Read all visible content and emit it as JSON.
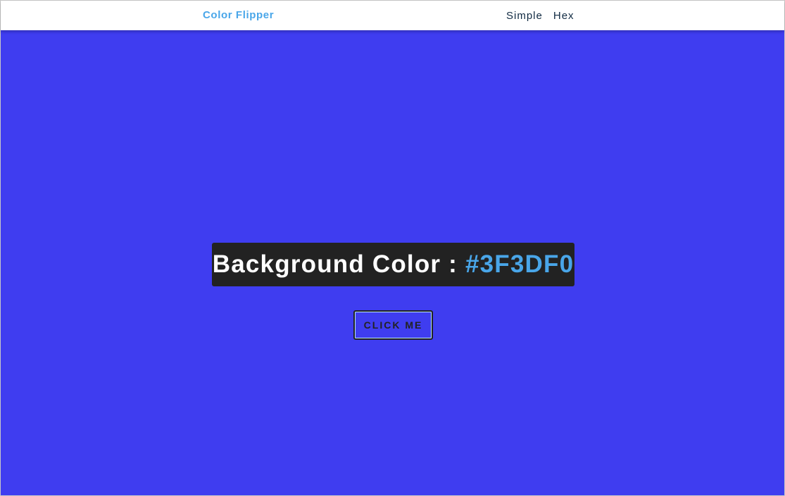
{
  "colors": {
    "background": "#3F3DF0",
    "brand": "#49A6E9",
    "nav_text": "#102A42",
    "box": "#222222"
  },
  "nav": {
    "brand": "Color Flipper",
    "links": [
      "Simple",
      "Hex"
    ]
  },
  "main": {
    "heading_prefix": "Background Color : ",
    "color_value": "#3F3DF0",
    "button_label": "CLICK ME"
  }
}
